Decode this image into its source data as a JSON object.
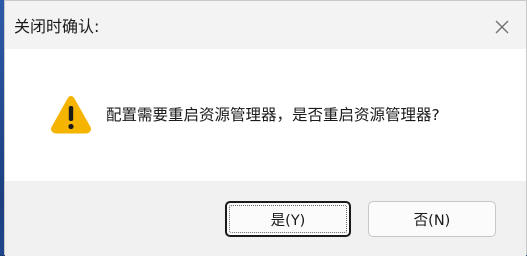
{
  "dialog": {
    "title": "关闭时确认:",
    "message": "配置需要重启资源管理器，是否重启资源管理器?",
    "icon": "warning-icon",
    "close_icon": "close-icon"
  },
  "buttons": {
    "yes_label": "是(Y)",
    "no_label": "否(N)"
  },
  "colors": {
    "title_bar": "#f3f3f3",
    "footer": "#f0f0f0",
    "warning_fill": "#f5b400",
    "focus_border": "#1a1a1a"
  }
}
